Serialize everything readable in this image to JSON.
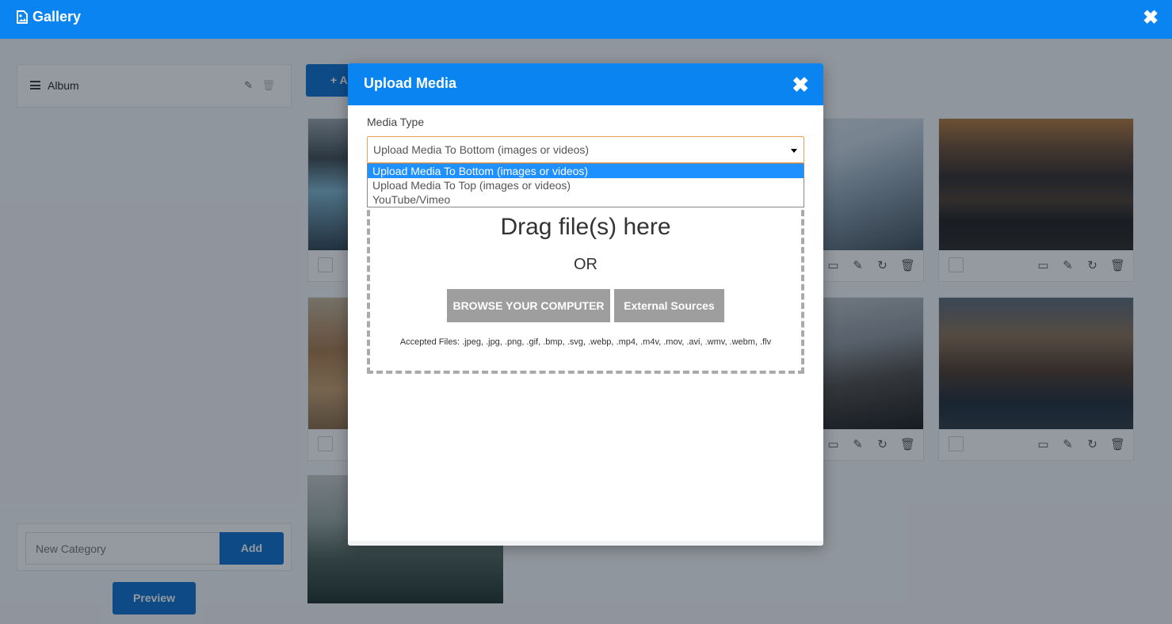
{
  "topbar": {
    "title": "Gallery",
    "close_icon": "close-icon"
  },
  "sidebar": {
    "album_label": "Album",
    "new_category_placeholder": "New Category",
    "add_label": "Add",
    "preview_label": "Preview"
  },
  "toolbar": {
    "add_media_label": "+ A"
  },
  "tiles": [
    {
      "name": "iceberg-lagoon"
    },
    {
      "name": "glacier"
    },
    {
      "name": "mountain-lake"
    },
    {
      "name": "desert-dunes"
    },
    {
      "name": "snowy-waterfall"
    },
    {
      "name": "kirkjufell-waterfall"
    },
    {
      "name": "misty-forest"
    }
  ],
  "modal": {
    "title": "Upload Media",
    "media_type_label": "Media Type",
    "selected_option": "Upload Media To Bottom (images or videos)",
    "options": [
      "Upload Media To Bottom (images or videos)",
      "Upload Media To Top (images or videos)",
      "YouTube/Vimeo"
    ],
    "drop_title": "Drag file(s) here",
    "or_text": "OR",
    "browse_label": "BROWSE YOUR COMPUTER",
    "external_label": "External Sources",
    "accepted_files": "Accepted Files: .jpeg, .jpg, .png, .gif, .bmp, .svg, .webp, .mp4, .m4v, .mov, .avi, .wmv, .webm, .flv"
  },
  "colors": {
    "header_blue": "#0a84f0",
    "button_blue": "#0a6fd0",
    "selected_option": "#1e90ff",
    "select_border": "#e8a55a",
    "grey_button": "#9e9e9e"
  }
}
